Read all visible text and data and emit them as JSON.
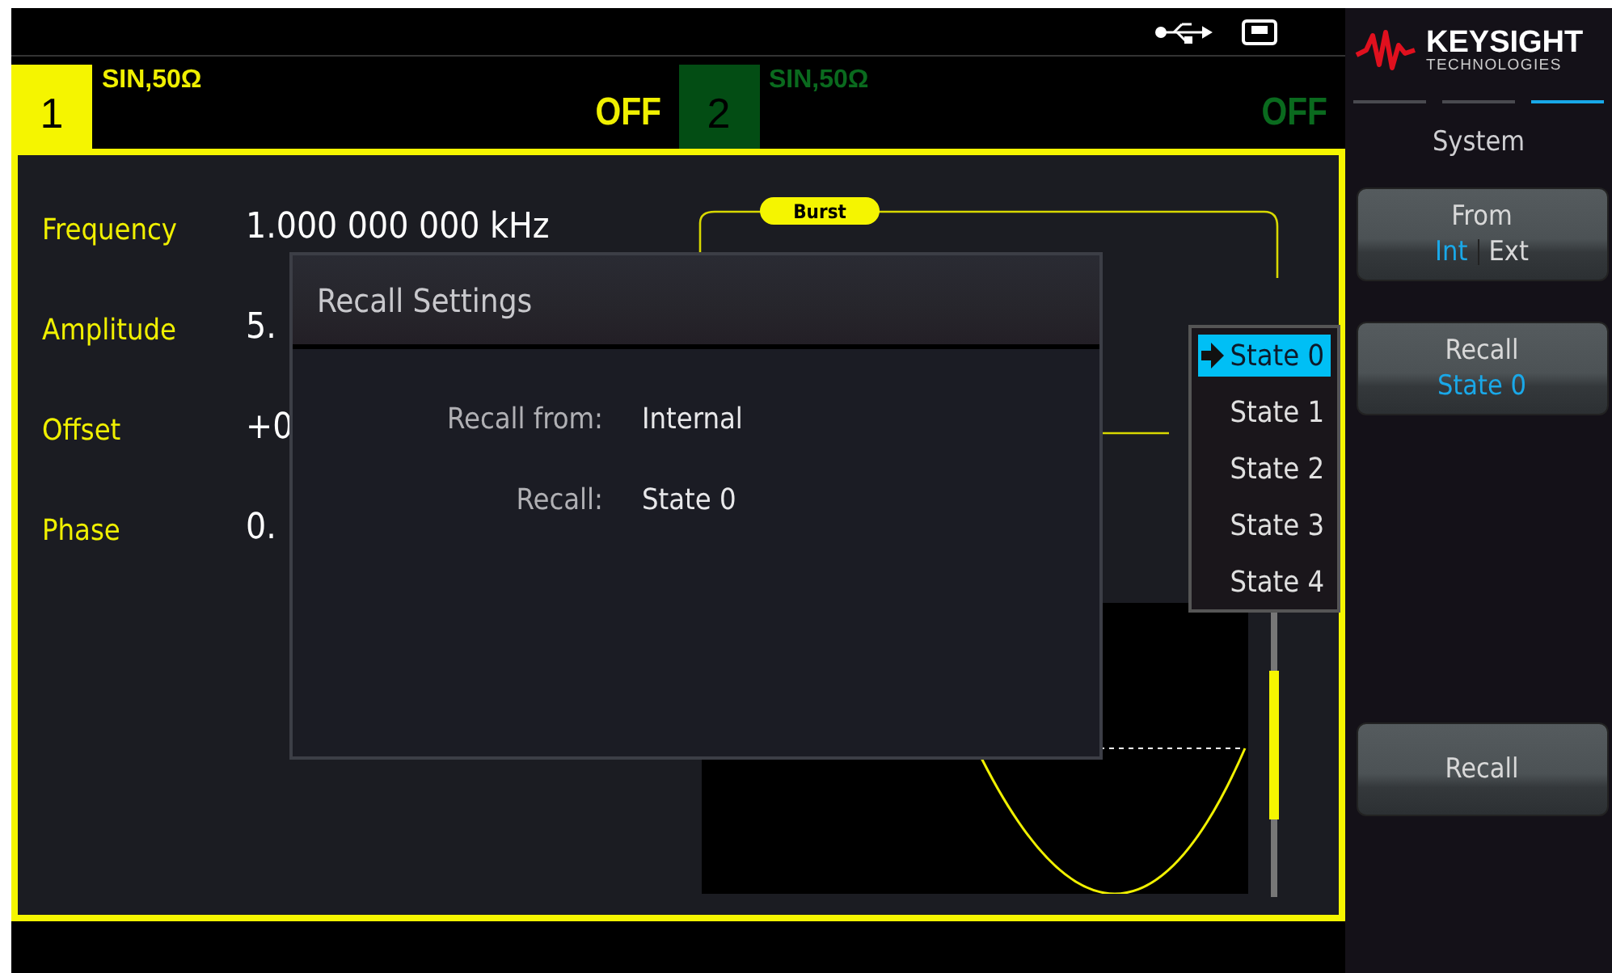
{
  "channels": [
    {
      "number": "1",
      "mode": "SIN,50Ω",
      "output": "OFF",
      "selected": true
    },
    {
      "number": "2",
      "mode": "SIN,50Ω",
      "output": "OFF",
      "selected": false
    }
  ],
  "parameters": [
    {
      "label": "Frequency",
      "value": "1.000 000 000 kHz"
    },
    {
      "label": "Amplitude",
      "value": "5."
    },
    {
      "label": "Offset",
      "value": "+0"
    },
    {
      "label": "Phase",
      "value": "0."
    }
  ],
  "diagram": {
    "badge": "Burst"
  },
  "dialog": {
    "title": "Recall Settings",
    "rows": [
      {
        "label": "Recall from:",
        "value": "Internal"
      },
      {
        "label": "Recall:",
        "value": "State 0"
      }
    ]
  },
  "dropdown": [
    {
      "label": "State 0",
      "selected": true
    },
    {
      "label": "State 1",
      "selected": false
    },
    {
      "label": "State 2",
      "selected": false
    },
    {
      "label": "State 3",
      "selected": false
    },
    {
      "label": "State 4",
      "selected": false
    }
  ],
  "logo": {
    "name": "KEYSIGHT",
    "sub": "TECHNOLOGIES"
  },
  "page_indicators": [
    {
      "selected": false
    },
    {
      "selected": false
    },
    {
      "selected": true
    }
  ],
  "menu_title": "System",
  "softkeys": [
    {
      "kind": "toggle",
      "label": "From",
      "options": [
        {
          "label": "Int",
          "selected": true
        },
        {
          "label": "Ext",
          "selected": false
        }
      ]
    },
    {
      "kind": "value",
      "label": "Recall",
      "value": "State 0"
    },
    {
      "kind": "spacer"
    },
    {
      "kind": "plain",
      "label": "Recall"
    }
  ]
}
